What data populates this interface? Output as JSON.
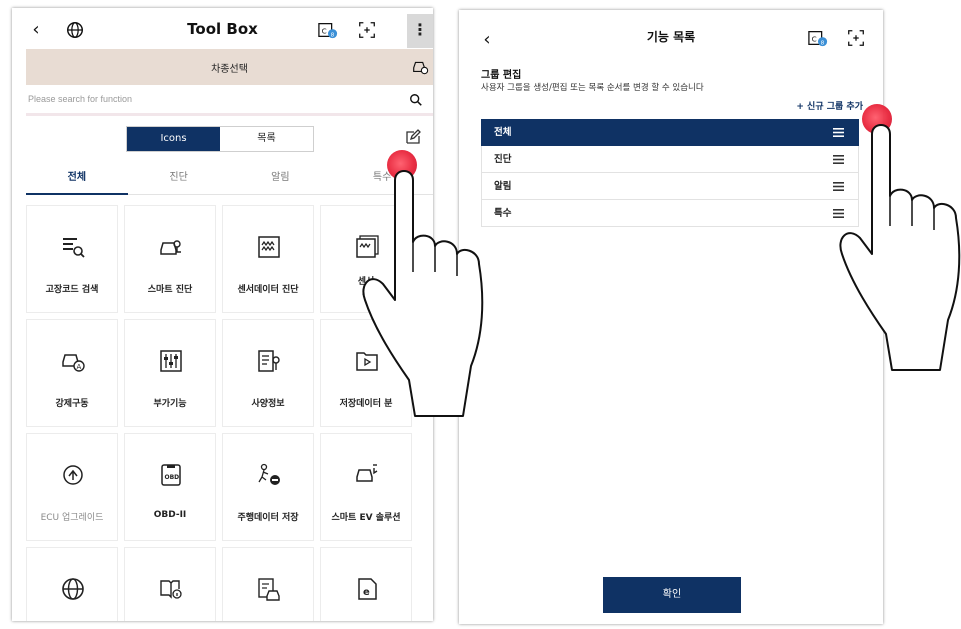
{
  "left_screen": {
    "title": "Tool Box",
    "kebab": "⋮",
    "vehicle_select": "차종선택",
    "search_placeholder": "Please search for function",
    "view_toggle": {
      "icons": "Icons",
      "list": "목록"
    },
    "tabs": [
      "전체",
      "진단",
      "알림",
      "특수"
    ],
    "tiles": [
      {
        "label": "고장코드 검색",
        "icon": "dtc-search-icon"
      },
      {
        "label": "스마트 진단",
        "icon": "smart-diagnosis-icon"
      },
      {
        "label": "센서데이터 진단",
        "icon": "sensor-data-icon"
      },
      {
        "label": "센서\n다",
        "icon": "sensor-data-multi-icon"
      },
      {
        "label": "강제구동",
        "icon": "forced-drive-icon"
      },
      {
        "label": "부가기능",
        "icon": "additional-function-icon"
      },
      {
        "label": "사양정보",
        "icon": "spec-info-icon"
      },
      {
        "label": "저장데이터 분",
        "icon": "saved-data-icon"
      },
      {
        "label": "ECU 업그레이드",
        "icon": "ecu-upgrade-icon",
        "dim": true
      },
      {
        "label": "OBD-II",
        "icon": "obd-icon"
      },
      {
        "label": "주행데이터 저장",
        "icon": "driving-data-icon"
      },
      {
        "label": "스마트 EV 솔루션",
        "icon": "ev-solution-icon"
      },
      {
        "label": "",
        "icon": "globe-icon"
      },
      {
        "label": "",
        "icon": "manual-info-icon"
      },
      {
        "label": "",
        "icon": "vehicle-doc-icon"
      },
      {
        "label": "",
        "icon": "e-document-icon"
      }
    ]
  },
  "right_screen": {
    "title": "기능 목록",
    "group_edit_heading": "그룹 편집",
    "group_edit_desc": "사용자 그룹을 생성/편집 또는 목록 순서를 변경 할 수 있습니다",
    "add_group": "+ 신규 그룹 추가",
    "groups": [
      "전체",
      "진단",
      "알림",
      "특수"
    ],
    "confirm": "확인"
  },
  "colors": {
    "primary_navy": "#0f3264",
    "vehicle_bar": "#e8dcd3",
    "tap_marker": "#e8243a"
  }
}
